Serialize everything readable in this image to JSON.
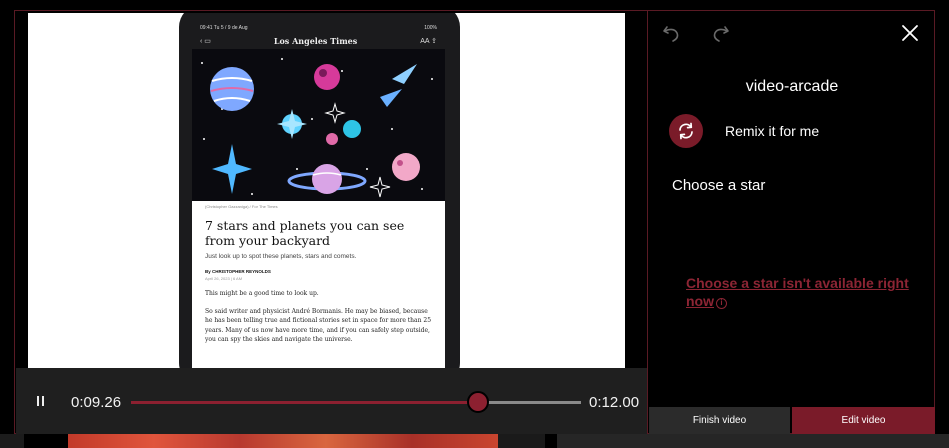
{
  "video": {
    "article": {
      "status_time": "09:41 Tu 5 / 9 de Aug",
      "status_battery": "100%",
      "publication": "Los Angeles Times",
      "image_credit": "(Christopher Gazzaniga) / For The Times",
      "headline": "7 stars and planets you can see from your backyard",
      "dek": "Just look up to spot these planets, stars and comets.",
      "byline": "By CHRISTOPHER REYNOLDS",
      "date": "April 26, 2023 | 6 AM",
      "para1": "This might be a good time to look up.",
      "para2": "So said writer and physicist André Bormanis. He may be biased, because he has been telling true and fictional stories set in space for more than 25 years. Many of us now have more time, and if you can safely step outside, you can spy the skies and navigate the universe."
    },
    "controls": {
      "current_time": "0:09.26",
      "total_time": "0:12.00",
      "progress": 0.7722
    }
  },
  "panel": {
    "title": "video-arcade",
    "remix_label": "Remix it for me",
    "choose_label": "Choose a star",
    "unavailable_text": "Choose a star isn't available right now",
    "finish_label": "Finish video",
    "edit_label": "Edit video"
  },
  "icons": {
    "undo": "undo-icon",
    "redo": "redo-icon",
    "close": "close-icon",
    "remix": "refresh-icon",
    "info": "info-icon",
    "pause": "pause-icon"
  },
  "colors": {
    "accent": "#7a1b29",
    "link": "#8c2534",
    "panel_bg": "#000000",
    "control_bg": "#1f1f1f"
  }
}
